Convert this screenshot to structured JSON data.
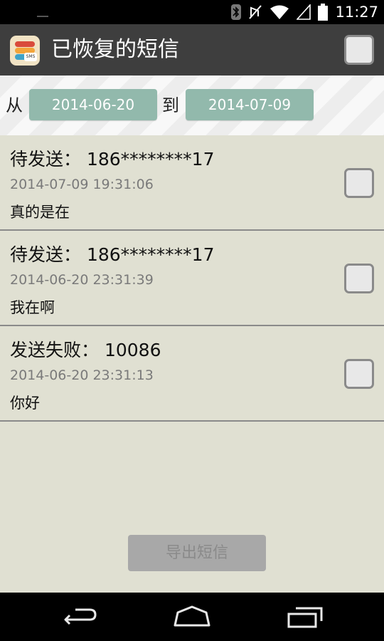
{
  "status_bar": {
    "time": "11:27",
    "icons": [
      "bluetooth-icon",
      "mute-icon",
      "wifi-icon",
      "signal-icon",
      "battery-icon"
    ]
  },
  "action_bar": {
    "title": "已恢复的短信",
    "app_icon": "sms-restore-app-icon",
    "app_icon_text": "SMS"
  },
  "filter": {
    "from_label": "从",
    "from_date": "2014-06-20",
    "to_label": "到",
    "to_date": "2014-07-09"
  },
  "messages": [
    {
      "status": "待发送：",
      "number": "186********17",
      "datetime": "2014-07-09 19:31:06",
      "body": "真的是在"
    },
    {
      "status": "待发送：",
      "number": "186********17",
      "datetime": "2014-06-20 23:31:39",
      "body": "我在啊"
    },
    {
      "status": "发送失败：",
      "number": "10086",
      "datetime": "2014-06-20 23:31:13",
      "body": "你好"
    }
  ],
  "export_button": {
    "label": "导出短信",
    "enabled": false
  },
  "colors": {
    "action_bar": "#3e3e3e",
    "date_button": "#92b9ac",
    "list_background": "#e0e0d2",
    "export_disabled": "#a8a8a8"
  },
  "nav_bar": {
    "buttons": [
      "back-icon",
      "home-icon",
      "recent-apps-icon"
    ]
  }
}
